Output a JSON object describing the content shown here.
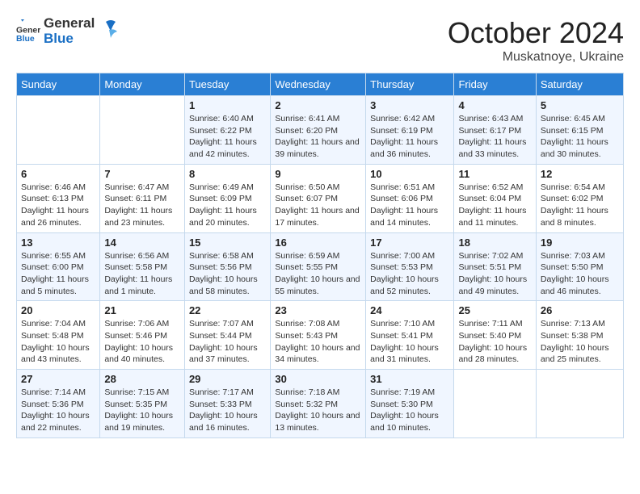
{
  "header": {
    "logo_general": "General",
    "logo_blue": "Blue",
    "title": "October 2024",
    "location": "Muskatnoye, Ukraine"
  },
  "days_of_week": [
    "Sunday",
    "Monday",
    "Tuesday",
    "Wednesday",
    "Thursday",
    "Friday",
    "Saturday"
  ],
  "weeks": [
    [
      {
        "day": "",
        "info": ""
      },
      {
        "day": "",
        "info": ""
      },
      {
        "day": "1",
        "info": "Sunrise: 6:40 AM\nSunset: 6:22 PM\nDaylight: 11 hours and 42 minutes."
      },
      {
        "day": "2",
        "info": "Sunrise: 6:41 AM\nSunset: 6:20 PM\nDaylight: 11 hours and 39 minutes."
      },
      {
        "day": "3",
        "info": "Sunrise: 6:42 AM\nSunset: 6:19 PM\nDaylight: 11 hours and 36 minutes."
      },
      {
        "day": "4",
        "info": "Sunrise: 6:43 AM\nSunset: 6:17 PM\nDaylight: 11 hours and 33 minutes."
      },
      {
        "day": "5",
        "info": "Sunrise: 6:45 AM\nSunset: 6:15 PM\nDaylight: 11 hours and 30 minutes."
      }
    ],
    [
      {
        "day": "6",
        "info": "Sunrise: 6:46 AM\nSunset: 6:13 PM\nDaylight: 11 hours and 26 minutes."
      },
      {
        "day": "7",
        "info": "Sunrise: 6:47 AM\nSunset: 6:11 PM\nDaylight: 11 hours and 23 minutes."
      },
      {
        "day": "8",
        "info": "Sunrise: 6:49 AM\nSunset: 6:09 PM\nDaylight: 11 hours and 20 minutes."
      },
      {
        "day": "9",
        "info": "Sunrise: 6:50 AM\nSunset: 6:07 PM\nDaylight: 11 hours and 17 minutes."
      },
      {
        "day": "10",
        "info": "Sunrise: 6:51 AM\nSunset: 6:06 PM\nDaylight: 11 hours and 14 minutes."
      },
      {
        "day": "11",
        "info": "Sunrise: 6:52 AM\nSunset: 6:04 PM\nDaylight: 11 hours and 11 minutes."
      },
      {
        "day": "12",
        "info": "Sunrise: 6:54 AM\nSunset: 6:02 PM\nDaylight: 11 hours and 8 minutes."
      }
    ],
    [
      {
        "day": "13",
        "info": "Sunrise: 6:55 AM\nSunset: 6:00 PM\nDaylight: 11 hours and 5 minutes."
      },
      {
        "day": "14",
        "info": "Sunrise: 6:56 AM\nSunset: 5:58 PM\nDaylight: 11 hours and 1 minute."
      },
      {
        "day": "15",
        "info": "Sunrise: 6:58 AM\nSunset: 5:56 PM\nDaylight: 10 hours and 58 minutes."
      },
      {
        "day": "16",
        "info": "Sunrise: 6:59 AM\nSunset: 5:55 PM\nDaylight: 10 hours and 55 minutes."
      },
      {
        "day": "17",
        "info": "Sunrise: 7:00 AM\nSunset: 5:53 PM\nDaylight: 10 hours and 52 minutes."
      },
      {
        "day": "18",
        "info": "Sunrise: 7:02 AM\nSunset: 5:51 PM\nDaylight: 10 hours and 49 minutes."
      },
      {
        "day": "19",
        "info": "Sunrise: 7:03 AM\nSunset: 5:50 PM\nDaylight: 10 hours and 46 minutes."
      }
    ],
    [
      {
        "day": "20",
        "info": "Sunrise: 7:04 AM\nSunset: 5:48 PM\nDaylight: 10 hours and 43 minutes."
      },
      {
        "day": "21",
        "info": "Sunrise: 7:06 AM\nSunset: 5:46 PM\nDaylight: 10 hours and 40 minutes."
      },
      {
        "day": "22",
        "info": "Sunrise: 7:07 AM\nSunset: 5:44 PM\nDaylight: 10 hours and 37 minutes."
      },
      {
        "day": "23",
        "info": "Sunrise: 7:08 AM\nSunset: 5:43 PM\nDaylight: 10 hours and 34 minutes."
      },
      {
        "day": "24",
        "info": "Sunrise: 7:10 AM\nSunset: 5:41 PM\nDaylight: 10 hours and 31 minutes."
      },
      {
        "day": "25",
        "info": "Sunrise: 7:11 AM\nSunset: 5:40 PM\nDaylight: 10 hours and 28 minutes."
      },
      {
        "day": "26",
        "info": "Sunrise: 7:13 AM\nSunset: 5:38 PM\nDaylight: 10 hours and 25 minutes."
      }
    ],
    [
      {
        "day": "27",
        "info": "Sunrise: 7:14 AM\nSunset: 5:36 PM\nDaylight: 10 hours and 22 minutes."
      },
      {
        "day": "28",
        "info": "Sunrise: 7:15 AM\nSunset: 5:35 PM\nDaylight: 10 hours and 19 minutes."
      },
      {
        "day": "29",
        "info": "Sunrise: 7:17 AM\nSunset: 5:33 PM\nDaylight: 10 hours and 16 minutes."
      },
      {
        "day": "30",
        "info": "Sunrise: 7:18 AM\nSunset: 5:32 PM\nDaylight: 10 hours and 13 minutes."
      },
      {
        "day": "31",
        "info": "Sunrise: 7:19 AM\nSunset: 5:30 PM\nDaylight: 10 hours and 10 minutes."
      },
      {
        "day": "",
        "info": ""
      },
      {
        "day": "",
        "info": ""
      }
    ]
  ]
}
